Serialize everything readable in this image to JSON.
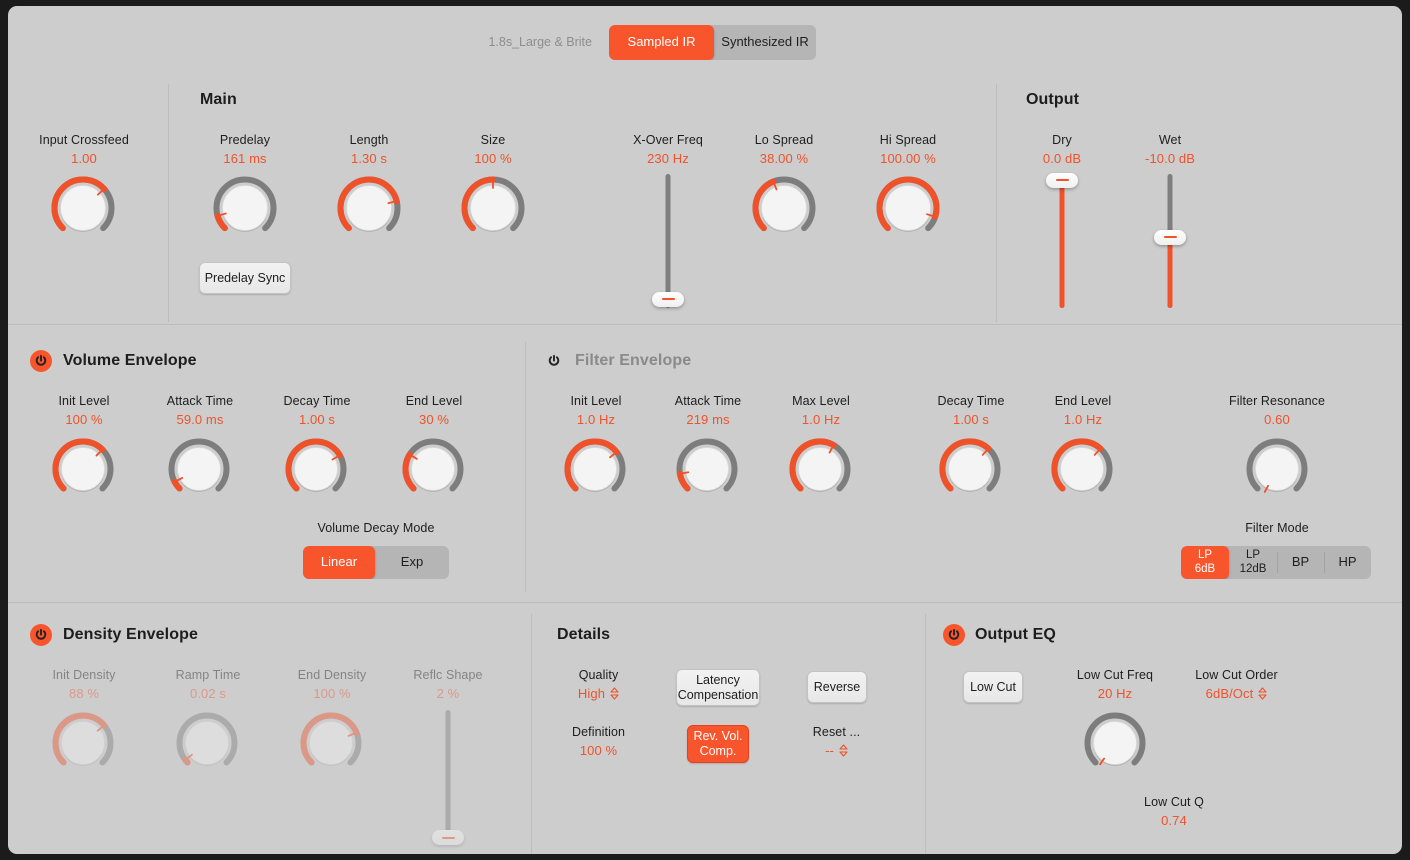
{
  "header": {
    "preset_name": "1.8s_Large & Brite",
    "ir_modes": [
      {
        "label": "Sampled IR",
        "active": true
      },
      {
        "label": "Synthesized IR",
        "active": false
      }
    ]
  },
  "main": {
    "title": "Main",
    "input_crossfeed": {
      "label": "Input Crossfeed",
      "value": "1.00",
      "arc_start": -135,
      "arc_end": 48,
      "pointer": 48
    },
    "predelay": {
      "label": "Predelay",
      "value": "161 ms",
      "arc_start": -135,
      "arc_end": -106,
      "pointer": -106
    },
    "length": {
      "label": "Length",
      "value": "1.30 s",
      "arc_start": -135,
      "arc_end": 76,
      "pointer": 76
    },
    "size": {
      "label": "Size",
      "value": "100 %",
      "arc_start": -135,
      "arc_end": 0,
      "pointer": 0
    },
    "predelay_sync": {
      "label": "Predelay Sync"
    },
    "xover_freq": {
      "label": "X-Over Freq",
      "value": "230 Hz",
      "pos_pct": 96
    },
    "lo_spread": {
      "label": "Lo Spread",
      "value": "38.00 %",
      "arc_start": -135,
      "arc_end": -22,
      "pointer": -22
    },
    "hi_spread": {
      "label": "Hi Spread",
      "value": "100.00 %",
      "arc_start": -135,
      "arc_end": 108,
      "pointer": 108
    }
  },
  "output": {
    "title": "Output",
    "dry": {
      "label": "Dry",
      "value": "0.0 dB",
      "pos_pct": 2
    },
    "wet": {
      "label": "Wet",
      "value": "-10.0 dB",
      "pos_pct": 47
    }
  },
  "volume_envelope": {
    "title": "Volume Envelope",
    "power_on": true,
    "knobs": [
      {
        "label": "Init Level",
        "value": "100 %",
        "arc_start": -135,
        "arc_end": 45,
        "pointer": 45
      },
      {
        "label": "Attack Time",
        "value": "59.0 ms",
        "arc_start": -135,
        "arc_end": -118,
        "pointer": -118
      },
      {
        "label": "Decay Time",
        "value": "1.00 s",
        "arc_start": -135,
        "arc_end": 60,
        "pointer": 60
      },
      {
        "label": "End Level",
        "value": "30 %",
        "arc_start": -135,
        "arc_end": -58,
        "pointer": -58
      }
    ],
    "decay_mode": {
      "label": "Volume Decay Mode",
      "options": [
        {
          "label": "Linear",
          "active": true
        },
        {
          "label": "Exp",
          "active": false
        }
      ]
    }
  },
  "filter_envelope": {
    "title": "Filter Envelope",
    "power_on": false,
    "knobs": [
      {
        "label": "Init Level",
        "value": "1.0 Hz",
        "arc_start": -135,
        "arc_end": 52,
        "pointer": 52
      },
      {
        "label": "Attack Time",
        "value": "219 ms",
        "arc_start": -135,
        "arc_end": -100,
        "pointer": -100
      },
      {
        "label": "Max Level",
        "value": "1.0 Hz",
        "arc_start": -135,
        "arc_end": 30,
        "pointer": 30
      },
      {
        "label": "Decay Time",
        "value": "1.00 s",
        "arc_start": -135,
        "arc_end": 42,
        "pointer": 42
      },
      {
        "label": "End Level",
        "value": "1.0 Hz",
        "arc_start": -135,
        "arc_end": 42,
        "pointer": 42
      }
    ],
    "resonance": {
      "label": "Filter Resonance",
      "value": "0.60",
      "arc_start": -135,
      "arc_end": -135,
      "pointer": -152
    },
    "filter_mode": {
      "label": "Filter Mode",
      "options": [
        {
          "label": "LP\n6dB",
          "active": true
        },
        {
          "label": "LP\n12dB",
          "active": false
        },
        {
          "label": "BP",
          "active": false
        },
        {
          "label": "HP",
          "active": false
        }
      ]
    }
  },
  "density_envelope": {
    "title": "Density Envelope",
    "power_on": true,
    "dimmed": true,
    "knobs": [
      {
        "label": "Init Density",
        "value": "88 %",
        "arc_start": -135,
        "arc_end": 50,
        "pointer": 50
      },
      {
        "label": "Ramp Time",
        "value": "0.02 s",
        "arc_start": -135,
        "arc_end": -128,
        "pointer": -128
      },
      {
        "label": "End Density",
        "value": "100 %",
        "arc_start": -135,
        "arc_end": 68,
        "pointer": 68
      }
    ],
    "reflc_shape": {
      "label": "Reflc Shape",
      "value": "2 %",
      "pos_pct": 98
    }
  },
  "details": {
    "title": "Details",
    "quality": {
      "label": "Quality",
      "value": "High"
    },
    "definition": {
      "label": "Definition",
      "value": "100 %"
    },
    "latency_compensation": {
      "label": "Latency\nCompensation",
      "active": false
    },
    "rev_vol_comp": {
      "label": "Rev. Vol.\nComp.",
      "active": true
    },
    "reverse": {
      "label": "Reverse",
      "active": false
    },
    "reset": {
      "label": "Reset ...",
      "value": "--"
    }
  },
  "output_eq": {
    "title": "Output EQ",
    "power_on": true,
    "low_cut_button": {
      "label": "Low Cut",
      "active": false
    },
    "low_cut_freq": {
      "label": "Low Cut Freq",
      "value": "20 Hz",
      "arc_start": -135,
      "arc_end": -135,
      "pointer": -145
    },
    "low_cut_order": {
      "label": "Low Cut Order",
      "value": "6dB/Oct"
    },
    "low_cut_q": {
      "label": "Low Cut Q",
      "value": "0.74"
    }
  },
  "colors": {
    "accent": "#f9552c",
    "value_text": "#f0522a",
    "panel": "#cdcdcd",
    "track": "#7e7e7e"
  }
}
